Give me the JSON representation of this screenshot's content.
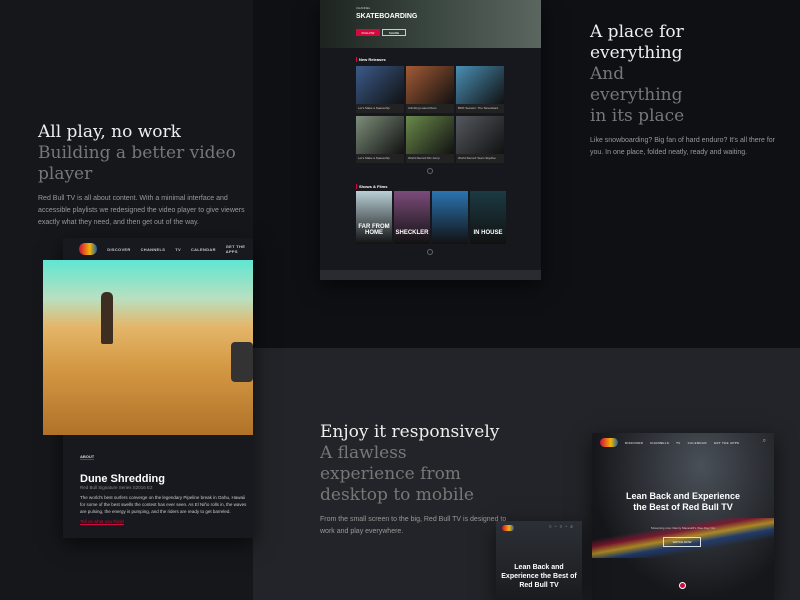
{
  "section1": {
    "title": "All play, no work",
    "subtitle": "Building a better video player",
    "body": "Red Bull TV is all about content. With a minimal interface and accessible playlists we redesigned the video player to give viewers exactly what they need, and then get out of the way."
  },
  "section2": {
    "title": "A place for everything",
    "subtitle": "And everything in its place",
    "body": "Like snowboarding? Big fan of hard enduro? It's all there for you. In one place, folded neatly, ready and waiting."
  },
  "section3": {
    "title": "Enjoy it responsively",
    "subtitle": "A flawless experience from desktop to mobile",
    "body": "From the small screen to the big, Red Bull TV is designed to work and play everywhere."
  },
  "nav": {
    "logo": "Red Bull TV",
    "items": [
      "DISCOVER",
      "CHANNELS",
      "TV",
      "CALENDAR",
      "GET THE APPS"
    ]
  },
  "player": {
    "about": "ABOUT",
    "title": "Dune Shredding",
    "series": "Red Bull Signature Series S2016 E2",
    "description": "The world's best surfers converge on the legendary Pipeline break in Oahu, Hawaii for some of the best swells the contest has ever seen. As El Niño rolls in, the waves are pulsing, the energy is pumping, and the riders are ready to get barreled.",
    "link": "Tell us what you think!"
  },
  "channel": {
    "tag": "CHANNEL",
    "title": "SKATEBOARDING",
    "primary": "FOLLOW",
    "secondary": "SHARE",
    "new_releases": "New Releases",
    "releases": [
      {
        "title": "Let's Make a Spaceship",
        "color": "#3b5a8a"
      },
      {
        "title": "Climbing Latest Runs",
        "color": "#a35a35"
      },
      {
        "title": "BMX Session: The Streetstars",
        "color": "#4a8fb5"
      },
      {
        "title": "Let's Make a Spaceship",
        "color": "#7d8e7a"
      },
      {
        "title": "World Record DH Jump",
        "color": "#6a8a4a"
      },
      {
        "title": "World Record Team Skydive",
        "color": "#54585e"
      }
    ],
    "shows_label": "Shows & Films",
    "shows": [
      {
        "title": "FAR FROM HOME",
        "color": "#b9cfd6"
      },
      {
        "title": "SHECKLER",
        "color": "#7c4b7a"
      },
      {
        "title": "",
        "color": "#2a74b0"
      },
      {
        "title": "IN HOUSE",
        "color": "#1b3a42"
      }
    ]
  },
  "hero": {
    "headline": "Lean Back and Experience the Best of Red Bull TV",
    "streaming": "Streaming now: Danny Macaskill's Wee Day Out",
    "cta": "WATCH NOW"
  },
  "colors": {
    "accent": "#d20a3c"
  }
}
